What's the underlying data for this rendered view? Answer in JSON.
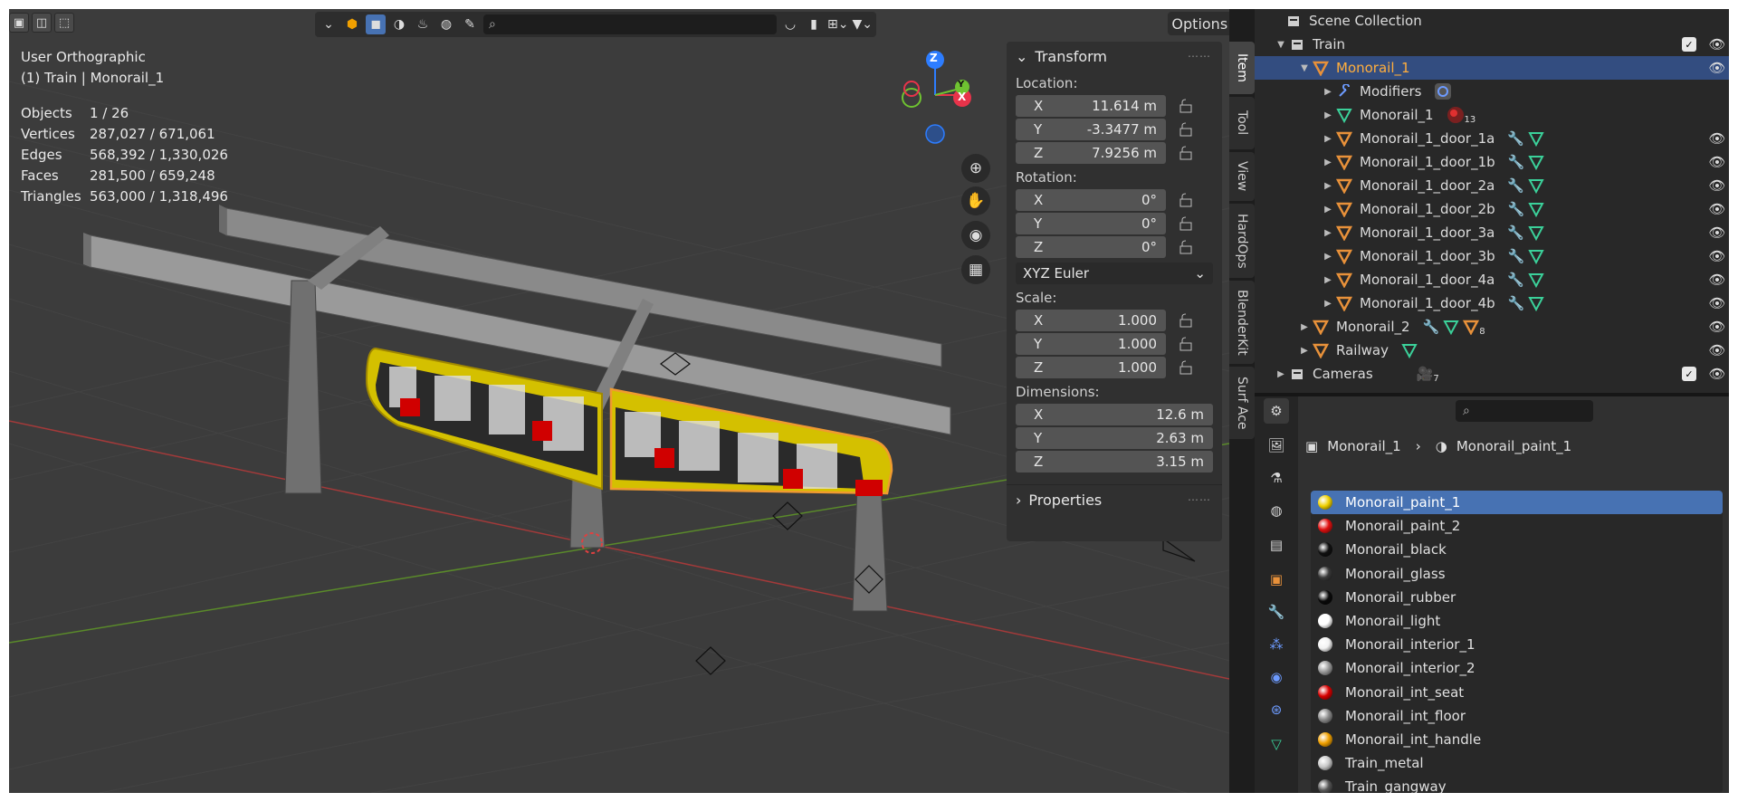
{
  "viewport": {
    "view_name": "User Orthographic",
    "context": "(1) Train | Monorail_1",
    "stats": [
      {
        "label": "Objects",
        "value": "1 / 26"
      },
      {
        "label": "Vertices",
        "value": "287,027 / 671,061"
      },
      {
        "label": "Edges",
        "value": "568,392 / 1,330,026"
      },
      {
        "label": "Faces",
        "value": "281,500 / 659,248"
      },
      {
        "label": "Triangles",
        "value": "563,000 / 1,318,496"
      }
    ],
    "options_label": "Options",
    "gizmo": {
      "z": "Z",
      "y": "Y",
      "x": "X"
    }
  },
  "npanel": {
    "tabs": [
      "Item",
      "Tool",
      "View",
      "HardOps",
      "BlenderKit",
      "Surf Ace"
    ],
    "active_tab": "Item",
    "transform_title": "Transform",
    "location_label": "Location:",
    "location": [
      {
        "axis": "X",
        "value": "11.614 m"
      },
      {
        "axis": "Y",
        "value": "-3.3477 m"
      },
      {
        "axis": "Z",
        "value": "7.9256 m"
      }
    ],
    "rotation_label": "Rotation:",
    "rotation": [
      {
        "axis": "X",
        "value": "0°"
      },
      {
        "axis": "Y",
        "value": "0°"
      },
      {
        "axis": "Z",
        "value": "0°"
      }
    ],
    "rotation_mode": "XYZ Euler",
    "scale_label": "Scale:",
    "scale": [
      {
        "axis": "X",
        "value": "1.000"
      },
      {
        "axis": "Y",
        "value": "1.000"
      },
      {
        "axis": "Z",
        "value": "1.000"
      }
    ],
    "dimensions_label": "Dimensions:",
    "dimensions": [
      {
        "axis": "X",
        "value": "12.6 m"
      },
      {
        "axis": "Y",
        "value": "2.63 m"
      },
      {
        "axis": "Z",
        "value": "3.15 m"
      }
    ],
    "properties_title": "Properties"
  },
  "outliner": {
    "scene_collection": "Scene Collection",
    "rows": [
      {
        "name": "Train",
        "type": "collection"
      },
      {
        "name": "Monorail_1",
        "type": "mesh",
        "selected": true
      },
      {
        "name": "Modifiers",
        "type": "modifiers"
      },
      {
        "name": "Monorail_1",
        "type": "meshdata",
        "badge": "13"
      },
      {
        "name": "Monorail_1_door_1a",
        "type": "mesh"
      },
      {
        "name": "Monorail_1_door_1b",
        "type": "mesh"
      },
      {
        "name": "Monorail_1_door_2a",
        "type": "mesh"
      },
      {
        "name": "Monorail_1_door_2b",
        "type": "mesh"
      },
      {
        "name": "Monorail_1_door_3a",
        "type": "mesh"
      },
      {
        "name": "Monorail_1_door_3b",
        "type": "mesh"
      },
      {
        "name": "Monorail_1_door_4a",
        "type": "mesh"
      },
      {
        "name": "Monorail_1_door_4b",
        "type": "mesh"
      },
      {
        "name": "Monorail_2",
        "type": "mesh",
        "badge": "8"
      },
      {
        "name": "Railway",
        "type": "mesh"
      },
      {
        "name": "Cameras",
        "type": "collection",
        "badge": "7"
      }
    ]
  },
  "properties": {
    "search_placeholder": "",
    "breadcrumb_object": "Monorail_1",
    "breadcrumb_material": "Monorail_paint_1",
    "materials": [
      {
        "name": "Monorail_paint_1",
        "color": "#f0d000",
        "selected": true
      },
      {
        "name": "Monorail_paint_2",
        "color": "#e01010"
      },
      {
        "name": "Monorail_black",
        "color": "#111111"
      },
      {
        "name": "Monorail_glass",
        "color": "#3a3a3a"
      },
      {
        "name": "Monorail_rubber",
        "color": "#0a0a0a"
      },
      {
        "name": "Monorail_light",
        "color": "#ffffff"
      },
      {
        "name": "Monorail_interior_1",
        "color": "#f2f2f2"
      },
      {
        "name": "Monorail_interior_2",
        "color": "#9a9a9a"
      },
      {
        "name": "Monorail_int_seat",
        "color": "#d80000"
      },
      {
        "name": "Monorail_int_floor",
        "color": "#8a8a8a"
      },
      {
        "name": "Monorail_int_handle",
        "color": "#f0a000"
      },
      {
        "name": "Train_metal",
        "color": "#c8c8c8"
      },
      {
        "name": "Train_gangway",
        "color": "#555555"
      }
    ]
  },
  "colors": {
    "accent": "#4772b3",
    "selection": "#334d80",
    "active_object": "#ffae3d",
    "mesh_icon": "#e8913a",
    "data_icon": "#3bd19a",
    "modifier_icon": "#6d9bff"
  }
}
